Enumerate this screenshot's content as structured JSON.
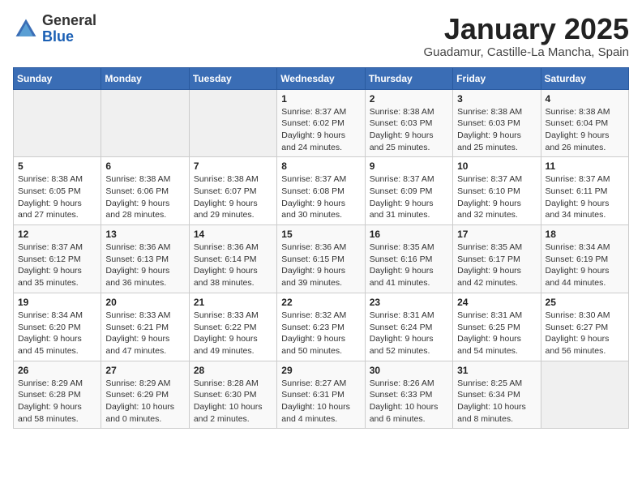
{
  "header": {
    "logo_general": "General",
    "logo_blue": "Blue",
    "month_title": "January 2025",
    "location": "Guadamur, Castille-La Mancha, Spain"
  },
  "weekdays": [
    "Sunday",
    "Monday",
    "Tuesday",
    "Wednesday",
    "Thursday",
    "Friday",
    "Saturday"
  ],
  "weeks": [
    [
      {
        "day": "",
        "info": ""
      },
      {
        "day": "",
        "info": ""
      },
      {
        "day": "",
        "info": ""
      },
      {
        "day": "1",
        "info": "Sunrise: 8:37 AM\nSunset: 6:02 PM\nDaylight: 9 hours\nand 24 minutes."
      },
      {
        "day": "2",
        "info": "Sunrise: 8:38 AM\nSunset: 6:03 PM\nDaylight: 9 hours\nand 25 minutes."
      },
      {
        "day": "3",
        "info": "Sunrise: 8:38 AM\nSunset: 6:03 PM\nDaylight: 9 hours\nand 25 minutes."
      },
      {
        "day": "4",
        "info": "Sunrise: 8:38 AM\nSunset: 6:04 PM\nDaylight: 9 hours\nand 26 minutes."
      }
    ],
    [
      {
        "day": "5",
        "info": "Sunrise: 8:38 AM\nSunset: 6:05 PM\nDaylight: 9 hours\nand 27 minutes."
      },
      {
        "day": "6",
        "info": "Sunrise: 8:38 AM\nSunset: 6:06 PM\nDaylight: 9 hours\nand 28 minutes."
      },
      {
        "day": "7",
        "info": "Sunrise: 8:38 AM\nSunset: 6:07 PM\nDaylight: 9 hours\nand 29 minutes."
      },
      {
        "day": "8",
        "info": "Sunrise: 8:37 AM\nSunset: 6:08 PM\nDaylight: 9 hours\nand 30 minutes."
      },
      {
        "day": "9",
        "info": "Sunrise: 8:37 AM\nSunset: 6:09 PM\nDaylight: 9 hours\nand 31 minutes."
      },
      {
        "day": "10",
        "info": "Sunrise: 8:37 AM\nSunset: 6:10 PM\nDaylight: 9 hours\nand 32 minutes."
      },
      {
        "day": "11",
        "info": "Sunrise: 8:37 AM\nSunset: 6:11 PM\nDaylight: 9 hours\nand 34 minutes."
      }
    ],
    [
      {
        "day": "12",
        "info": "Sunrise: 8:37 AM\nSunset: 6:12 PM\nDaylight: 9 hours\nand 35 minutes."
      },
      {
        "day": "13",
        "info": "Sunrise: 8:36 AM\nSunset: 6:13 PM\nDaylight: 9 hours\nand 36 minutes."
      },
      {
        "day": "14",
        "info": "Sunrise: 8:36 AM\nSunset: 6:14 PM\nDaylight: 9 hours\nand 38 minutes."
      },
      {
        "day": "15",
        "info": "Sunrise: 8:36 AM\nSunset: 6:15 PM\nDaylight: 9 hours\nand 39 minutes."
      },
      {
        "day": "16",
        "info": "Sunrise: 8:35 AM\nSunset: 6:16 PM\nDaylight: 9 hours\nand 41 minutes."
      },
      {
        "day": "17",
        "info": "Sunrise: 8:35 AM\nSunset: 6:17 PM\nDaylight: 9 hours\nand 42 minutes."
      },
      {
        "day": "18",
        "info": "Sunrise: 8:34 AM\nSunset: 6:19 PM\nDaylight: 9 hours\nand 44 minutes."
      }
    ],
    [
      {
        "day": "19",
        "info": "Sunrise: 8:34 AM\nSunset: 6:20 PM\nDaylight: 9 hours\nand 45 minutes."
      },
      {
        "day": "20",
        "info": "Sunrise: 8:33 AM\nSunset: 6:21 PM\nDaylight: 9 hours\nand 47 minutes."
      },
      {
        "day": "21",
        "info": "Sunrise: 8:33 AM\nSunset: 6:22 PM\nDaylight: 9 hours\nand 49 minutes."
      },
      {
        "day": "22",
        "info": "Sunrise: 8:32 AM\nSunset: 6:23 PM\nDaylight: 9 hours\nand 50 minutes."
      },
      {
        "day": "23",
        "info": "Sunrise: 8:31 AM\nSunset: 6:24 PM\nDaylight: 9 hours\nand 52 minutes."
      },
      {
        "day": "24",
        "info": "Sunrise: 8:31 AM\nSunset: 6:25 PM\nDaylight: 9 hours\nand 54 minutes."
      },
      {
        "day": "25",
        "info": "Sunrise: 8:30 AM\nSunset: 6:27 PM\nDaylight: 9 hours\nand 56 minutes."
      }
    ],
    [
      {
        "day": "26",
        "info": "Sunrise: 8:29 AM\nSunset: 6:28 PM\nDaylight: 9 hours\nand 58 minutes."
      },
      {
        "day": "27",
        "info": "Sunrise: 8:29 AM\nSunset: 6:29 PM\nDaylight: 10 hours\nand 0 minutes."
      },
      {
        "day": "28",
        "info": "Sunrise: 8:28 AM\nSunset: 6:30 PM\nDaylight: 10 hours\nand 2 minutes."
      },
      {
        "day": "29",
        "info": "Sunrise: 8:27 AM\nSunset: 6:31 PM\nDaylight: 10 hours\nand 4 minutes."
      },
      {
        "day": "30",
        "info": "Sunrise: 8:26 AM\nSunset: 6:33 PM\nDaylight: 10 hours\nand 6 minutes."
      },
      {
        "day": "31",
        "info": "Sunrise: 8:25 AM\nSunset: 6:34 PM\nDaylight: 10 hours\nand 8 minutes."
      },
      {
        "day": "",
        "info": ""
      }
    ]
  ]
}
